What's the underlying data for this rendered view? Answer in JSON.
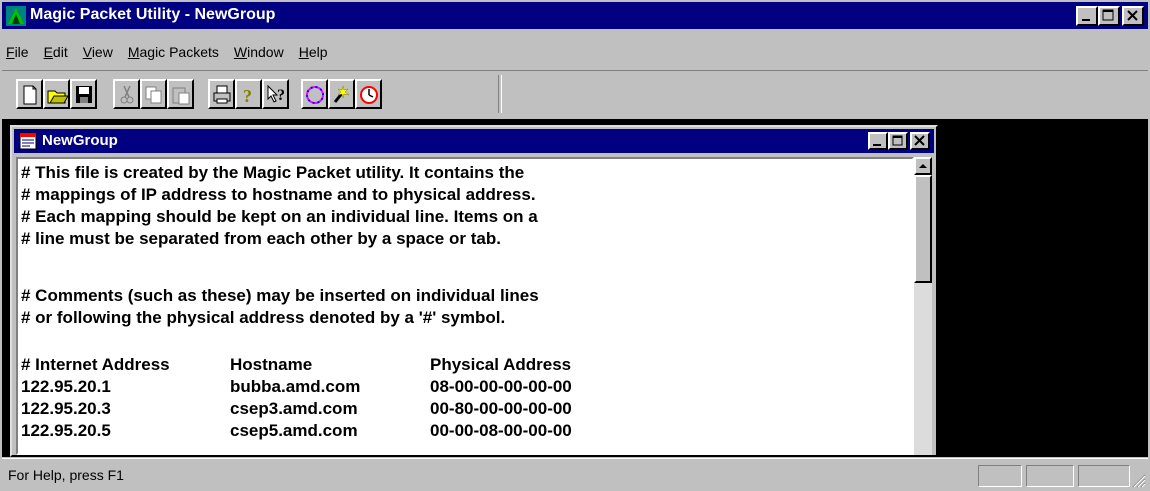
{
  "window": {
    "title": "Magic Packet Utility - NewGroup"
  },
  "menu": [
    "File",
    "Edit",
    "View",
    "Magic Packets",
    "Window",
    "Help"
  ],
  "toolbar": {
    "groups": [
      [
        "new-icon",
        "open-folder-icon",
        "save-disk-icon"
      ],
      [
        "cut-icon",
        "copy-icon",
        "paste-icon"
      ],
      [
        "print-icon",
        "help-icon",
        "context-help-icon"
      ],
      [
        "magic-packet-ring-icon",
        "wakeup-icon",
        "timer-icon"
      ]
    ]
  },
  "child": {
    "title": "NewGroup",
    "lines": [
      "# This file is created by the Magic Packet utility.  It contains the",
      "# mappings of IP address to hostname and to physical address.",
      "# Each mapping should be kept on an individual line.  Items on a",
      "# line must be separated from each other by a space or tab.",
      "",
      "# Comments (such as these) may be inserted on individual lines",
      "# or following the physical address denoted by a '#' symbol."
    ],
    "table": {
      "headers": [
        "# Internet Address",
        "Hostname",
        "Physical Address"
      ],
      "rows": [
        [
          "122.95.20.1",
          "bubba.amd.com",
          "08-00-00-00-00-00"
        ],
        [
          "122.95.20.3",
          "csep3.amd.com",
          "00-80-00-00-00-00"
        ],
        [
          "122.95.20.5",
          "csep5.amd.com",
          "00-00-08-00-00-00"
        ]
      ]
    }
  },
  "status": {
    "text": "For Help, press F1"
  },
  "colors": {
    "titlebar": "#000080",
    "face": "#c0c0c0",
    "mdi_background": "#000000"
  }
}
